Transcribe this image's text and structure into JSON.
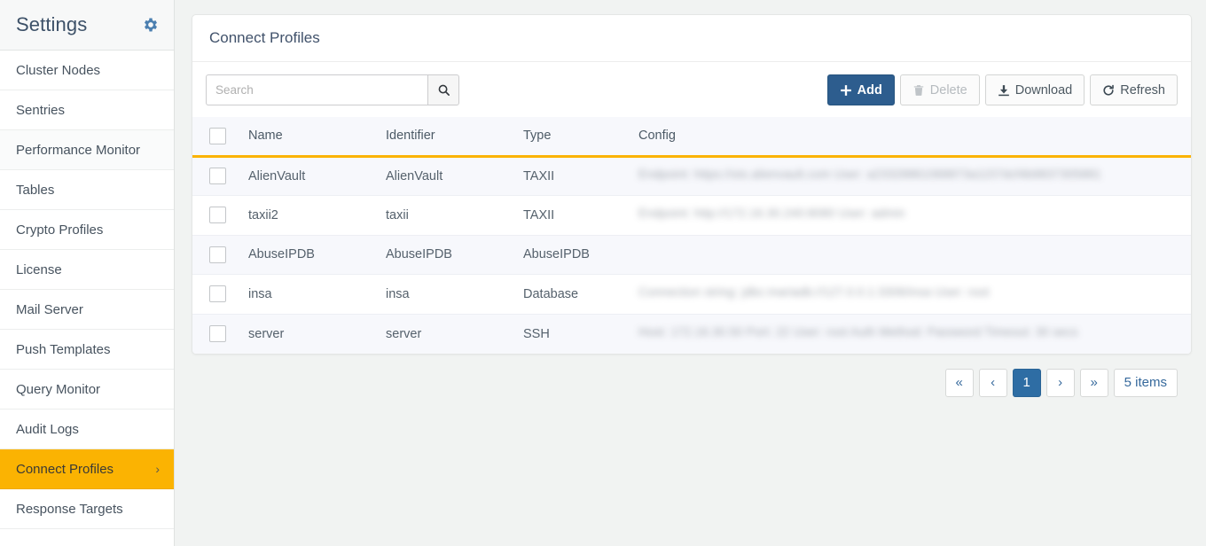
{
  "sidebar": {
    "title": "Settings",
    "gear_icon": "gear-icon",
    "items": [
      {
        "label": "Cluster Nodes",
        "active": false
      },
      {
        "label": "Sentries",
        "active": false
      },
      {
        "label": "Performance Monitor",
        "active": false
      },
      {
        "label": "Tables",
        "active": false
      },
      {
        "label": "Crypto Profiles",
        "active": false
      },
      {
        "label": "License",
        "active": false
      },
      {
        "label": "Mail Server",
        "active": false
      },
      {
        "label": "Push Templates",
        "active": false
      },
      {
        "label": "Query Monitor",
        "active": false
      },
      {
        "label": "Audit Logs",
        "active": false
      },
      {
        "label": "Connect Profiles",
        "active": true,
        "chevron": "›"
      },
      {
        "label": "Response Targets",
        "active": false
      }
    ]
  },
  "panel": {
    "title": "Connect Profiles"
  },
  "search": {
    "value": "",
    "placeholder": "Search",
    "button_icon": "search-icon"
  },
  "toolbar": {
    "add_label": "Add",
    "delete_label": "Delete",
    "download_label": "Download",
    "refresh_label": "Refresh",
    "add_icon": "plus-icon",
    "delete_icon": "trash-icon",
    "download_icon": "download-icon",
    "refresh_icon": "refresh-icon",
    "delete_disabled": true
  },
  "table": {
    "select_all_checked": false,
    "columns": [
      "Name",
      "Identifier",
      "Type",
      "Config"
    ],
    "rows": [
      {
        "checked": false,
        "name": "AlienVault",
        "identifier": "AlienVault",
        "type": "TAXII",
        "config": "Endpoint: https://otx.alienvault.com  User: a23328861068873a1157dcf4b9837305881"
      },
      {
        "checked": false,
        "name": "taxii2",
        "identifier": "taxii",
        "type": "TAXII",
        "config": "Endpoint: http://172.16.30.240:8080  User: admin"
      },
      {
        "checked": false,
        "name": "AbuseIPDB",
        "identifier": "AbuseIPDB",
        "type": "AbuseIPDB",
        "config": ""
      },
      {
        "checked": false,
        "name": "insa",
        "identifier": "insa",
        "type": "Database",
        "config": "Connection string: jdbc:mariadb://127.0.0.1:3306/insa  User: root"
      },
      {
        "checked": false,
        "name": "server",
        "identifier": "server",
        "type": "SSH",
        "config": "Host: 172.16.30.50  Port: 22  User: root  Auth Method: Password  Timeout: 30 secs"
      }
    ]
  },
  "pagination": {
    "first_label": "«",
    "prev_label": "‹",
    "page_label": "1",
    "next_label": "›",
    "last_label": "»",
    "items_label": "5 items"
  },
  "colors": {
    "accent_amber": "#fbb302",
    "primary_blue": "#2d5d8e",
    "link_blue": "#36699c",
    "page_bg": "#f1f3f2"
  }
}
